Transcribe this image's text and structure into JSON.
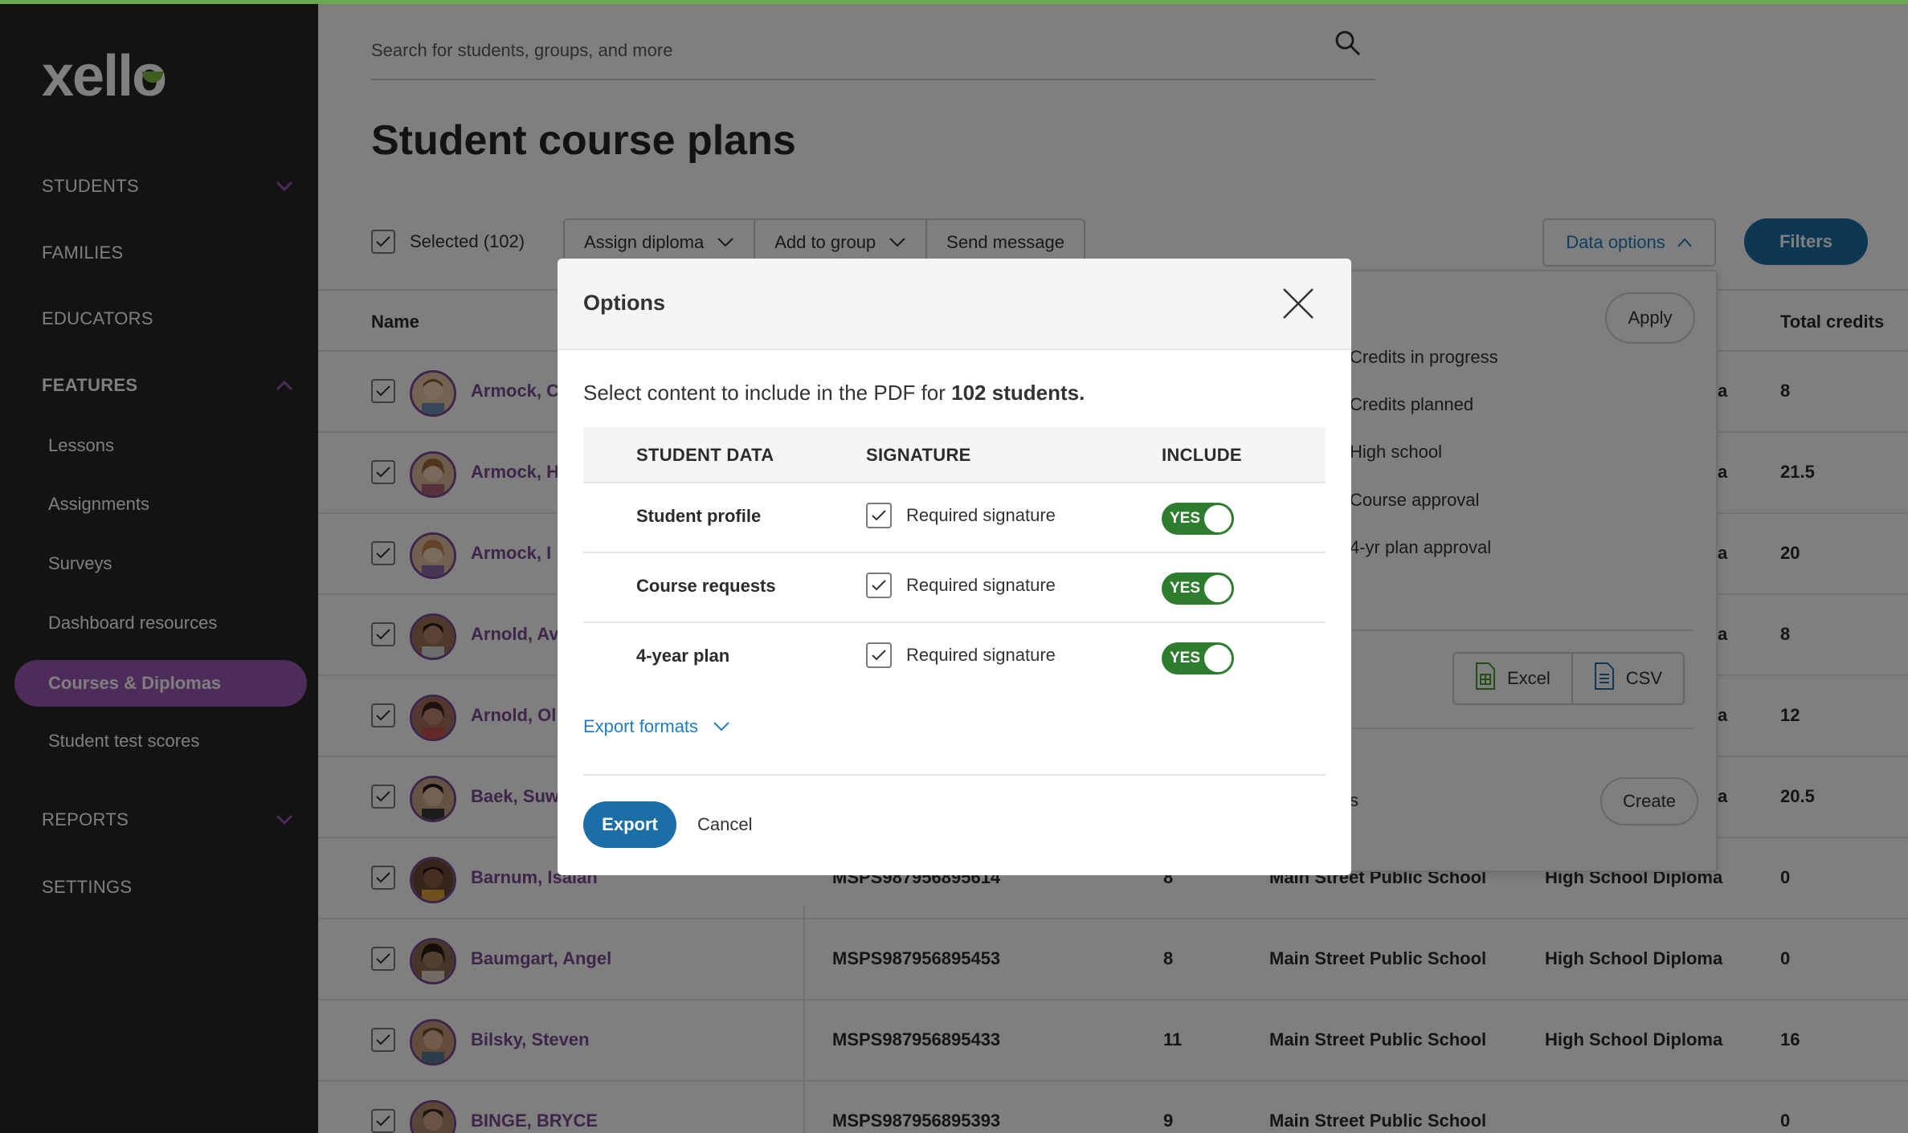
{
  "brand": {
    "logo": "xello",
    "accent": "#9a59b5",
    "green": "#7ac143",
    "blue": "#1b6ea6"
  },
  "sidebar": {
    "sections": [
      {
        "label": "STUDENTS",
        "chevron": "chevron-down-icon"
      },
      {
        "label": "FAMILIES"
      },
      {
        "label": "EDUCATORS"
      },
      {
        "label": "FEATURES",
        "chevron": "chevron-up-icon"
      },
      {
        "label": "REPORTS",
        "chevron": "chevron-down-icon"
      },
      {
        "label": "SETTINGS"
      }
    ],
    "features": [
      "Lessons",
      "Assignments",
      "Surveys",
      "Dashboard resources",
      "Courses & Diplomas",
      "Student test scores"
    ],
    "active": "Courses & Diplomas"
  },
  "search": {
    "placeholder": "Search for students, groups, and more"
  },
  "page": {
    "title": "Student course plans"
  },
  "toolbar": {
    "selected": "Selected (102)",
    "assign_diploma": "Assign diploma",
    "add_to_group": "Add to group",
    "send_message": "Send message",
    "data_options": "Data options",
    "filters": "Filters"
  },
  "table": {
    "headers": {
      "name": "Name",
      "total_credits": "Total credits"
    },
    "rows": [
      {
        "name": "Armock, C",
        "partial": "a",
        "credits": "8"
      },
      {
        "name": "Armock, H",
        "partial": "a",
        "credits": "21.5"
      },
      {
        "name": "Armock, I",
        "partial": "a",
        "credits": "20"
      },
      {
        "name": "Arnold, Av",
        "partial": "a",
        "credits": "8"
      },
      {
        "name": "Arnold, Ol",
        "partial": "a",
        "credits": "12"
      },
      {
        "name": "Baek, Suw",
        "partial": "a",
        "credits": "20.5"
      },
      {
        "name": "Barnum, Isaiah",
        "id": "MSPS987956895614",
        "grade": "8",
        "school": "Main Street Public School",
        "diploma": "High School Diploma",
        "credits": "0"
      },
      {
        "name": "Baumgart, Angel",
        "id": "MSPS987956895453",
        "grade": "8",
        "school": "Main Street Public School",
        "diploma": "High School Diploma",
        "credits": "0"
      },
      {
        "name": "Bilsky, Steven",
        "id": "MSPS987956895433",
        "grade": "11",
        "school": "Main Street Public School",
        "diploma": "High School Diploma",
        "credits": "16"
      },
      {
        "name": "BINGE, BRYCE",
        "id": "MSPS987956895393",
        "grade": "9",
        "school": "Main Street Public School",
        "diploma": "",
        "credits": "0"
      }
    ]
  },
  "data_options_panel": {
    "apply": "Apply",
    "options": [
      "Credits in progress",
      "Credits planned",
      "High school",
      "Course approval",
      "4-yr plan approval"
    ],
    "excel": "Excel",
    "csv": "CSV",
    "partial": "s",
    "create": "Create"
  },
  "modal": {
    "title": "Options",
    "desc_prefix": "Select content to include in the PDF for ",
    "desc_count": "102 students.",
    "columns": {
      "data": "STUDENT DATA",
      "signature": "SIGNATURE",
      "include": "INCLUDE"
    },
    "rows": [
      {
        "label": "Student profile",
        "signature": "Required signature",
        "include": "YES"
      },
      {
        "label": "Course requests",
        "signature": "Required signature",
        "include": "YES"
      },
      {
        "label": "4-year plan",
        "signature": "Required signature",
        "include": "YES"
      }
    ],
    "export_formats": "Export formats",
    "export": "Export",
    "cancel": "Cancel"
  }
}
